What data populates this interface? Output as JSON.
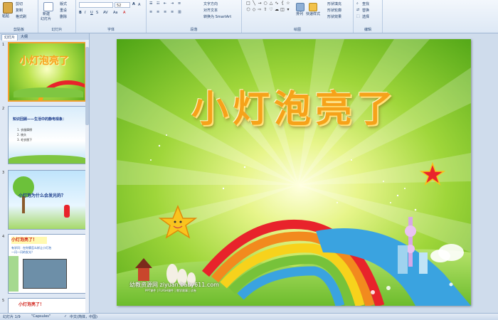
{
  "ribbon": {
    "groups": [
      {
        "label": "剪贴板"
      },
      {
        "label": "幻灯片"
      },
      {
        "label": "字体"
      },
      {
        "label": "段落"
      },
      {
        "label": "绘图"
      },
      {
        "label": "编辑"
      }
    ],
    "clipboard": {
      "paste": "粘贴",
      "cut": "剪切",
      "copy": "复制",
      "format_painter": "格式刷"
    },
    "slides": {
      "new_slide": "新建",
      "new_slide2": "幻灯片",
      "layout": "版式",
      "reset": "重设",
      "delete": "删除"
    },
    "font": {
      "size_value": "52"
    },
    "paragraph": {
      "text_direction": "文字方向",
      "align_text": "对齐文本",
      "smartart": "转换为 SmartArt"
    },
    "drawing": {
      "arrange": "排列",
      "quick_styles": "快速样式",
      "fill": "形状填充",
      "outline": "形状轮廓",
      "effects": "形状效果"
    },
    "editing": {
      "find": "查找",
      "replace": "替换",
      "select": "选择"
    }
  },
  "panel": {
    "tab_slides": "幻灯片",
    "tab_outline": "大纲",
    "thumbs": [
      {
        "num": "1",
        "title": "小灯泡亮了"
      },
      {
        "num": "2",
        "heading": "知识回顾——生活中的静电现象：",
        "items": [
          "1. 衣服摩擦",
          "2. 梳头",
          "3. 毛衣脱下"
        ]
      },
      {
        "num": "3",
        "title": "小灯泡为什么会发光的？"
      },
      {
        "num": "4",
        "title": "小灯泡亮了！",
        "body": "有学问：在你猜怎么样让小灯泡一闪一闪的发光？"
      },
      {
        "num": "5",
        "title": "小灯泡亮了！"
      }
    ]
  },
  "slide": {
    "title": "小灯泡亮了",
    "watermark": "幼教资源网 ziyuan.baby611.com",
    "watermark_sub": "PPT课件 | FLASH课件 | 教学故事 | 试卷"
  },
  "status": {
    "slide_info": "幻灯片 1/9",
    "theme": "\"Capsules\"",
    "language": "中文(简体，中国)"
  },
  "colors": {
    "title": "#f6a21a",
    "selection": "#f29f2f",
    "ribbon_text": "#1b3a66"
  }
}
